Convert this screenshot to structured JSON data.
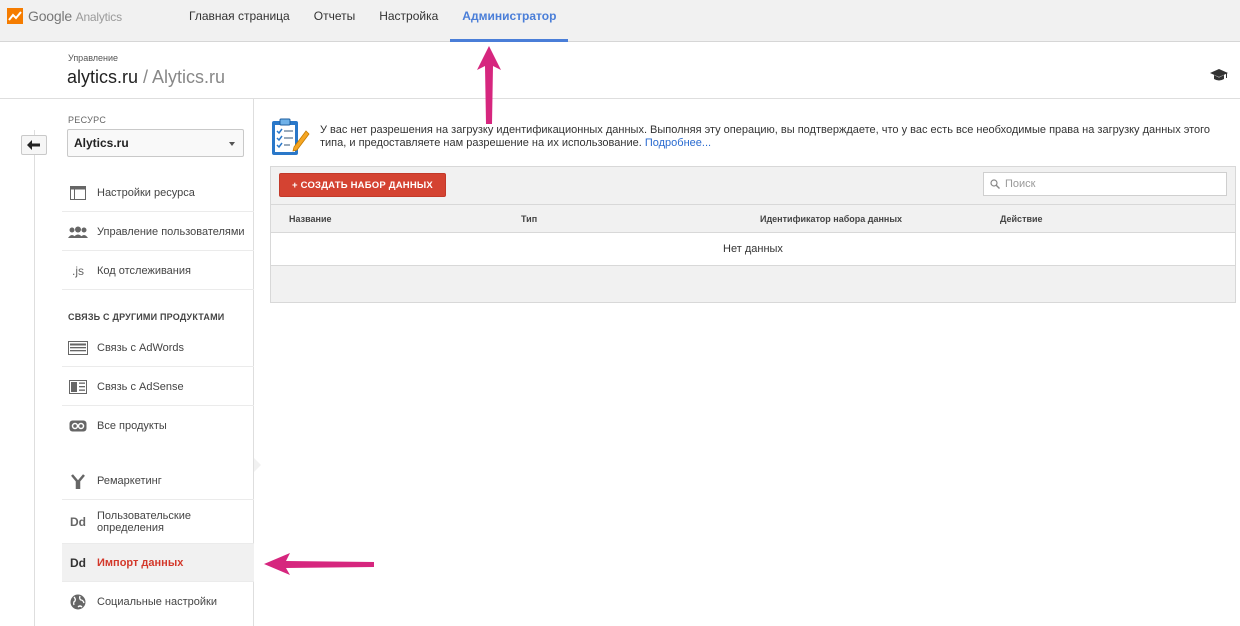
{
  "app": {
    "logo_google": "Google",
    "logo_analytics": "Analytics"
  },
  "nav": [
    {
      "label": "Главная страница"
    },
    {
      "label": "Отчеты"
    },
    {
      "label": "Настройка"
    },
    {
      "label": "Администратор",
      "active": true
    }
  ],
  "header": {
    "small": "Управление",
    "title": "alytics.ru",
    "subtitle": "/ Alytics.ru"
  },
  "sidebar": {
    "resource_label": "РЕСУРС",
    "resource_value": "Alytics.ru",
    "items": [
      {
        "label": "Настройки ресурса",
        "icon": "layout-icon"
      },
      {
        "label": "Управление пользователями",
        "icon": "users-icon"
      },
      {
        "label": "Код отслеживания",
        "icon": "js-icon",
        "icon_text": ".js"
      }
    ],
    "section_label": "СВЯЗЬ С ДРУГИМИ ПРОДУКТАМИ",
    "products": [
      {
        "label": "Связь с AdWords",
        "icon": "adwords-icon"
      },
      {
        "label": "Связь с AdSense",
        "icon": "adsense-icon"
      },
      {
        "label": "Все продукты",
        "icon": "link-icon"
      }
    ],
    "data_items": [
      {
        "label": "Ремаркетинг",
        "icon": "remarketing-icon"
      },
      {
        "label_line1": "Пользовательские",
        "label_line2": "определения",
        "icon": "dd-icon",
        "icon_text": "Dd"
      },
      {
        "label": "Импорт данных",
        "icon": "dd-icon",
        "icon_text": "Dd",
        "active": true
      },
      {
        "label": "Социальные настройки",
        "icon": "globe-icon"
      }
    ]
  },
  "main": {
    "notice_text": "У вас нет разрешения на загрузку идентификационных данных. Выполняя эту операцию, вы подтверждаете, что у вас есть все необходимые права на загрузку данных этого типа, и предоставляете нам разрешение на их использование.",
    "notice_link": "Подробнее...",
    "create_button": "+ СОЗДАТЬ НАБОР ДАННЫХ",
    "search_placeholder": "Поиск",
    "table": {
      "columns": [
        "Название",
        "Тип",
        "Идентификатор набора данных",
        "Действие"
      ],
      "empty": "Нет данных"
    }
  },
  "colors": {
    "accent": "#4a7ed8",
    "create_button": "#d44332",
    "active_item": "#d3382a",
    "annotation_arrow": "#d6267e"
  }
}
